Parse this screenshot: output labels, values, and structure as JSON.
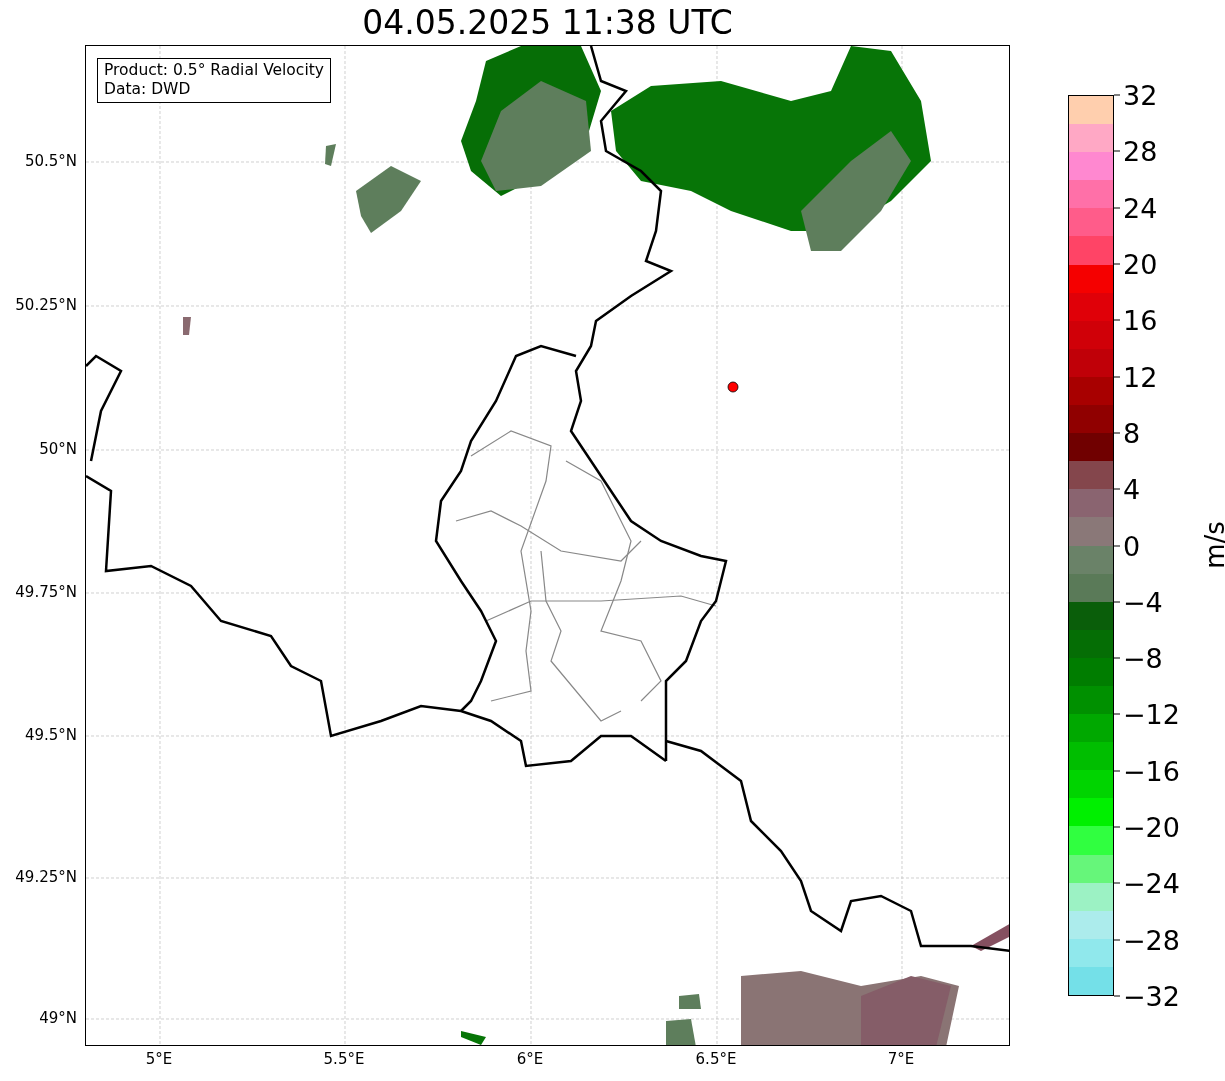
{
  "title": "04.05.2025 11:38 UTC",
  "info_box": {
    "lines": [
      "Product: 0.5° Radial Velocity",
      "Data: DWD"
    ]
  },
  "map": {
    "kind": "map",
    "y_ticks": [
      "50.5°N",
      "50.25°N",
      "50°N",
      "49.75°N",
      "49.5°N",
      "49.25°N",
      "49°N"
    ],
    "x_ticks": [
      "5°E",
      "5.5°E",
      "6°E",
      "6.5°E",
      "7°E"
    ]
  },
  "colorbar": {
    "label": "m/s",
    "ticks": [
      "32",
      "28",
      "24",
      "20",
      "16",
      "12",
      "8",
      "4",
      "0",
      "−4",
      "−8",
      "−12",
      "−16",
      "−20",
      "−24",
      "−28",
      "−32"
    ],
    "bins": [
      {
        "color": "#ffcfae"
      },
      {
        "color": "#ffa8c5"
      },
      {
        "color": "#ff88d0"
      },
      {
        "color": "#ff70a8"
      },
      {
        "color": "#ff5c8a"
      },
      {
        "color": "#ff4466"
      },
      {
        "color": "#f50000"
      },
      {
        "color": "#e00008"
      },
      {
        "color": "#d00008"
      },
      {
        "color": "#c00008"
      },
      {
        "color": "#a80000"
      },
      {
        "color": "#900000"
      },
      {
        "color": "#700000"
      },
      {
        "color": "#84464c"
      },
      {
        "color": "#8a6470"
      },
      {
        "color": "#8a7878"
      },
      {
        "color": "#6a8268"
      },
      {
        "color": "#5a7a58"
      },
      {
        "color": "#0a5e0a"
      },
      {
        "color": "#056e05"
      },
      {
        "color": "#007d00"
      },
      {
        "color": "#009000"
      },
      {
        "color": "#00a800"
      },
      {
        "color": "#00be00"
      },
      {
        "color": "#00d400"
      },
      {
        "color": "#00f000"
      },
      {
        "color": "#30ff40"
      },
      {
        "color": "#66f67a"
      },
      {
        "color": "#9cf2c4"
      },
      {
        "color": "#acecec"
      },
      {
        "color": "#90e8ec"
      },
      {
        "color": "#74e0e8"
      }
    ]
  }
}
